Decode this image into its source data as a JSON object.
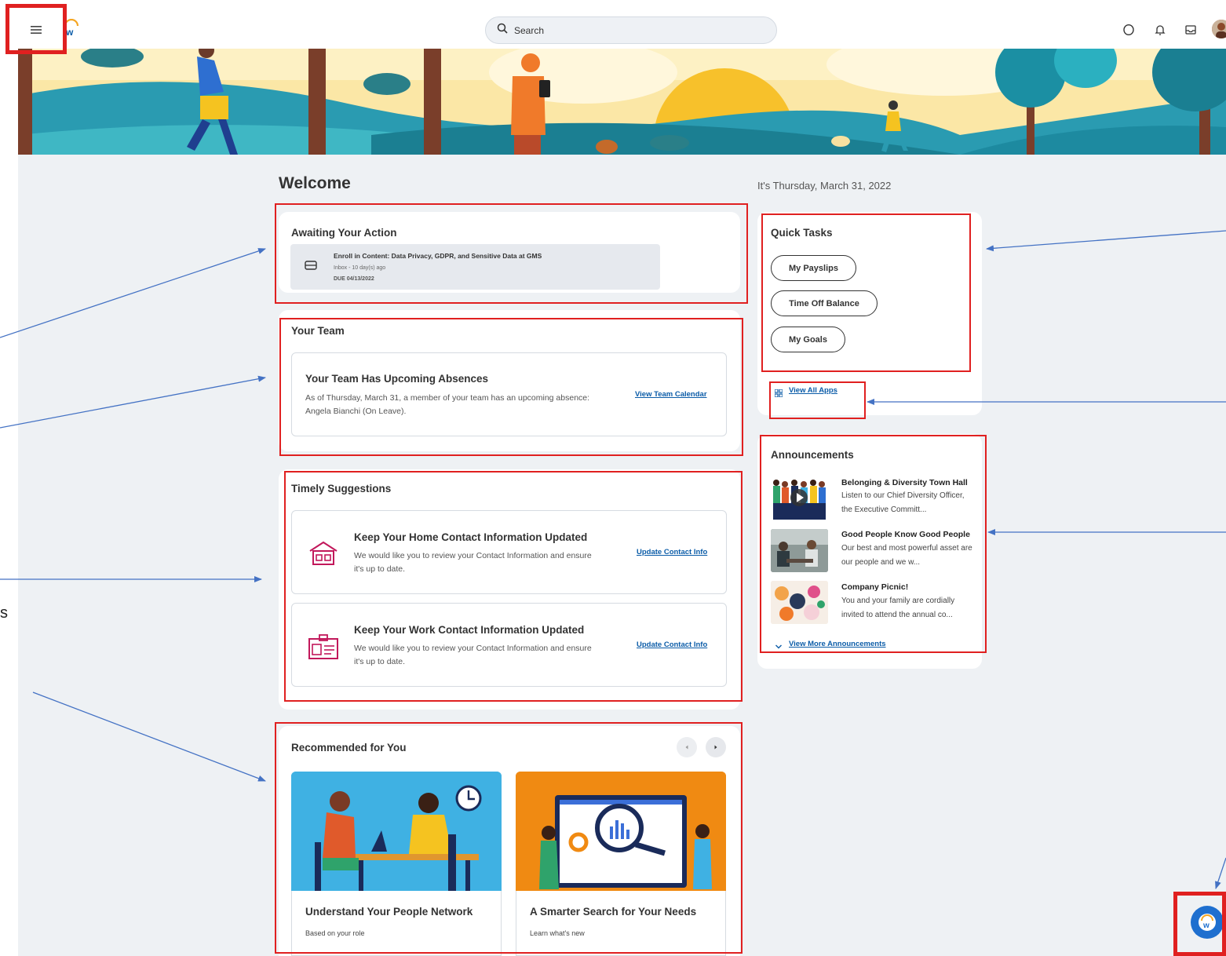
{
  "topbar": {
    "search_placeholder": "Search",
    "icons": [
      "menu-icon",
      "workday-logo",
      "search-icon",
      "chat-icon",
      "bell-icon",
      "inbox-icon",
      "avatar"
    ]
  },
  "welcome": "Welcome",
  "date_text": "It's Thursday, March 31, 2022",
  "awaiting": {
    "title": "Awaiting Your Action",
    "item": {
      "title": "Enroll in Content: Data Privacy, GDPR, and Sensitive Data at GMS",
      "meta": "Inbox - 10 day(s) ago",
      "due": "DUE 04/13/2022"
    }
  },
  "team": {
    "title": "Your Team",
    "card_title": "Your Team Has Upcoming Absences",
    "card_text": "As of Thursday, March 31, a member of your team has an upcoming absence: Angela Bianchi (On Leave).",
    "link": "View Team Calendar"
  },
  "suggestions": {
    "title": "Timely Suggestions",
    "items": [
      {
        "title": "Keep Your Home Contact Information Updated",
        "text": "We would like you to review your Contact Information and ensure it's up to date.",
        "link": "Update Contact Info",
        "icon": "home-icon"
      },
      {
        "title": "Keep Your Work Contact Information Updated",
        "text": "We would like you to review your Contact Information and ensure it's up to date.",
        "link": "Update Contact Info",
        "icon": "badge-icon"
      }
    ]
  },
  "recommended": {
    "title": "Recommended for You",
    "items": [
      {
        "title": "Understand Your People Network",
        "sub": "Based on your role"
      },
      {
        "title": "A Smarter Search for Your Needs",
        "sub": "Learn what's new"
      }
    ]
  },
  "quick_tasks": {
    "title": "Quick Tasks",
    "buttons": [
      "My Payslips",
      "Time Off Balance",
      "My Goals"
    ],
    "view_all": "View All Apps"
  },
  "announcements": {
    "title": "Announcements",
    "items": [
      {
        "title": "Belonging & Diversity Town Hall",
        "text": "Listen to our Chief Diversity Officer, the Executive Committ..."
      },
      {
        "title": "Good People Know Good People",
        "text": "Our best and most powerful asset are our people and we w..."
      },
      {
        "title": "Company Picnic!",
        "text": "You and your family are cordially invited to attend the annual co..."
      }
    ],
    "view_more": "View More Announcements"
  },
  "left_fragment": "s",
  "colors": {
    "accent_blue": "#0b5ca8",
    "highlight_red": "#e02020",
    "annotation_arrow": "#4472c4",
    "suggestion_icon": "#c2185b"
  }
}
